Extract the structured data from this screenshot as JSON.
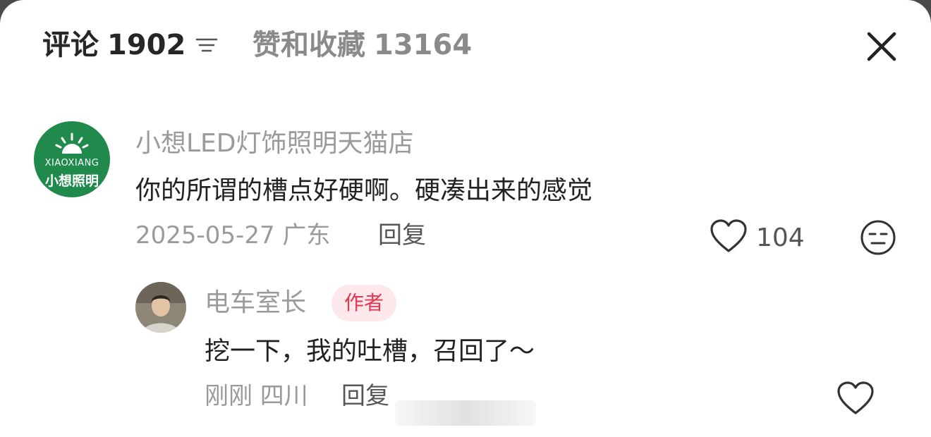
{
  "header": {
    "comments_tab_label": "评论",
    "comments_count": "1902",
    "likes_tab_label": "赞和收藏",
    "likes_count": "13164"
  },
  "comments": [
    {
      "username": "小想LED灯饰照明天猫店",
      "avatar_lines": [
        "XIAOXIANG",
        "小想照明"
      ],
      "text": "你的所谓的槽点好硬啊。硬凑出来的感觉",
      "meta": "2025-05-27 广东",
      "reply_label": "回复",
      "like_count": "104"
    }
  ],
  "replies": [
    {
      "username": "电车室长",
      "badge": "作者",
      "text": "挖一下，我的吐槽，召回了～",
      "meta": "刚刚 四川",
      "reply_label": "回复"
    }
  ],
  "colors": {
    "brand_green": "#1f8a4c",
    "author_badge_bg": "#fde8ec",
    "author_badge_text": "#e8344f"
  }
}
